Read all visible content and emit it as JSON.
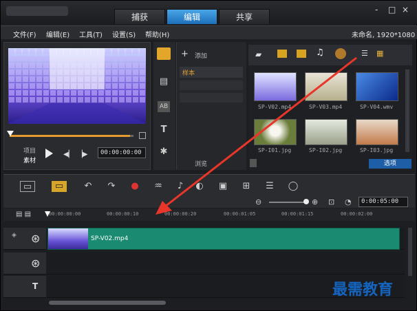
{
  "tabs": [
    {
      "label": "捕获"
    },
    {
      "label": "编辑"
    },
    {
      "label": "共享"
    }
  ],
  "window": {
    "min": "-",
    "max": "□",
    "close": "×"
  },
  "menu": [
    {
      "label": "文件(F)"
    },
    {
      "label": "编辑(E)"
    },
    {
      "label": "工具(T)"
    },
    {
      "label": "设置(S)"
    },
    {
      "label": "帮助(H)"
    }
  ],
  "project_info": "未命名, 1920*1080",
  "preview": {
    "project_label": "项目",
    "clip_label": "素材",
    "timecode": "00:00:00:00"
  },
  "library": {
    "add_label": "添加",
    "sample_label": "样本",
    "browse_label": "浏览",
    "options_label": "选项"
  },
  "thumbs": [
    {
      "caption": "SP-V02.mp4"
    },
    {
      "caption": "SP-V03.mp4"
    },
    {
      "caption": "SP-V04.wmv"
    },
    {
      "caption": "SP-I01.jpg"
    },
    {
      "caption": "SP-I02.jpg"
    },
    {
      "caption": "SP-I03.jpg"
    }
  ],
  "timeline": {
    "duration": "0:00:05:00",
    "ticks": [
      "00:00:00:00",
      "00:00:00:10",
      "00:00:00:20",
      "00:00:01:05",
      "00:00:01:15",
      "00:00:02:00"
    ]
  },
  "clip": {
    "name": "SP-V02.mp4"
  },
  "watermark": "最需教育"
}
